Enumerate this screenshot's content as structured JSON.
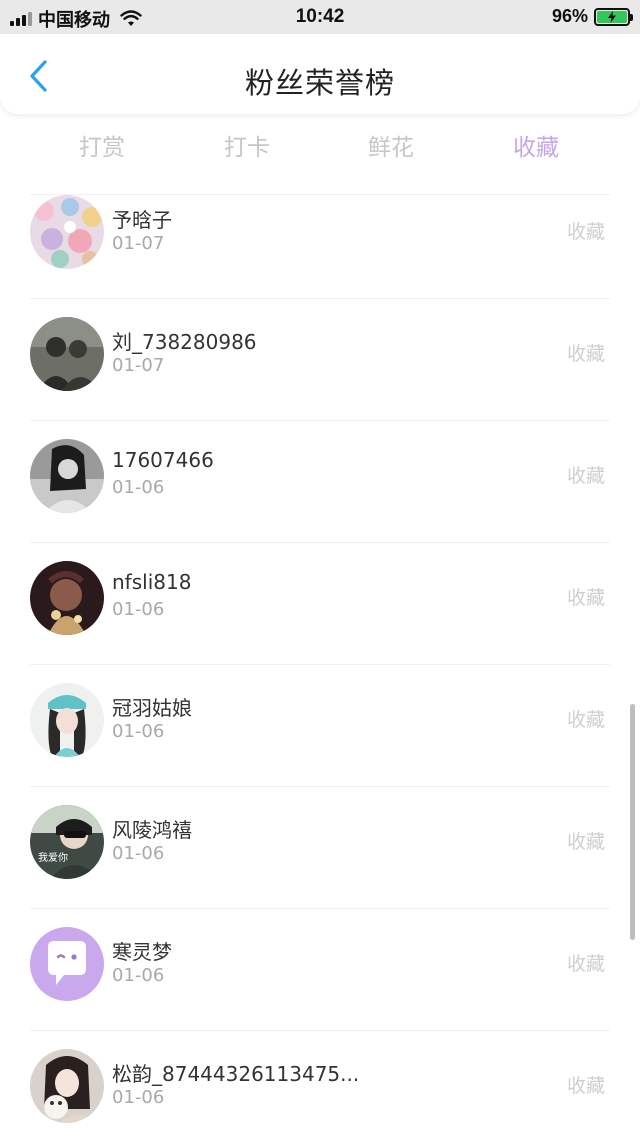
{
  "status_bar": {
    "carrier": "中国移动",
    "time": "10:42",
    "battery": "96%"
  },
  "navbar": {
    "title": "粉丝荣誉榜"
  },
  "tabs": [
    {
      "label": "打赏",
      "active": false
    },
    {
      "label": "打卡",
      "active": false
    },
    {
      "label": "鲜花",
      "active": false
    },
    {
      "label": "收藏",
      "active": true
    }
  ],
  "list": {
    "items": [
      {
        "name": "予晗子",
        "date": "01-07",
        "action": "收藏"
      },
      {
        "name": "刘_738280986",
        "date": "01-07",
        "action": "收藏"
      },
      {
        "name": "17607466",
        "date": "01-06",
        "action": "收藏"
      },
      {
        "name": "nfsli818",
        "date": "01-06",
        "action": "收藏"
      },
      {
        "name": "冠羽姑娘",
        "date": "01-06",
        "action": "收藏"
      },
      {
        "name": "风陵鸿禧",
        "date": "01-06",
        "action": "收藏"
      },
      {
        "name": "寒灵梦",
        "date": "01-06",
        "action": "收藏"
      },
      {
        "name": "松韵_87444326113475...",
        "date": "01-06",
        "action": "收藏"
      }
    ]
  },
  "avatar_overlay_text": "我爱你",
  "colors": {
    "accent": "#c7a6e6",
    "back_arrow": "#2aa3e6",
    "tab_inactive": "#c6c6c6",
    "battery": "#34c759"
  }
}
